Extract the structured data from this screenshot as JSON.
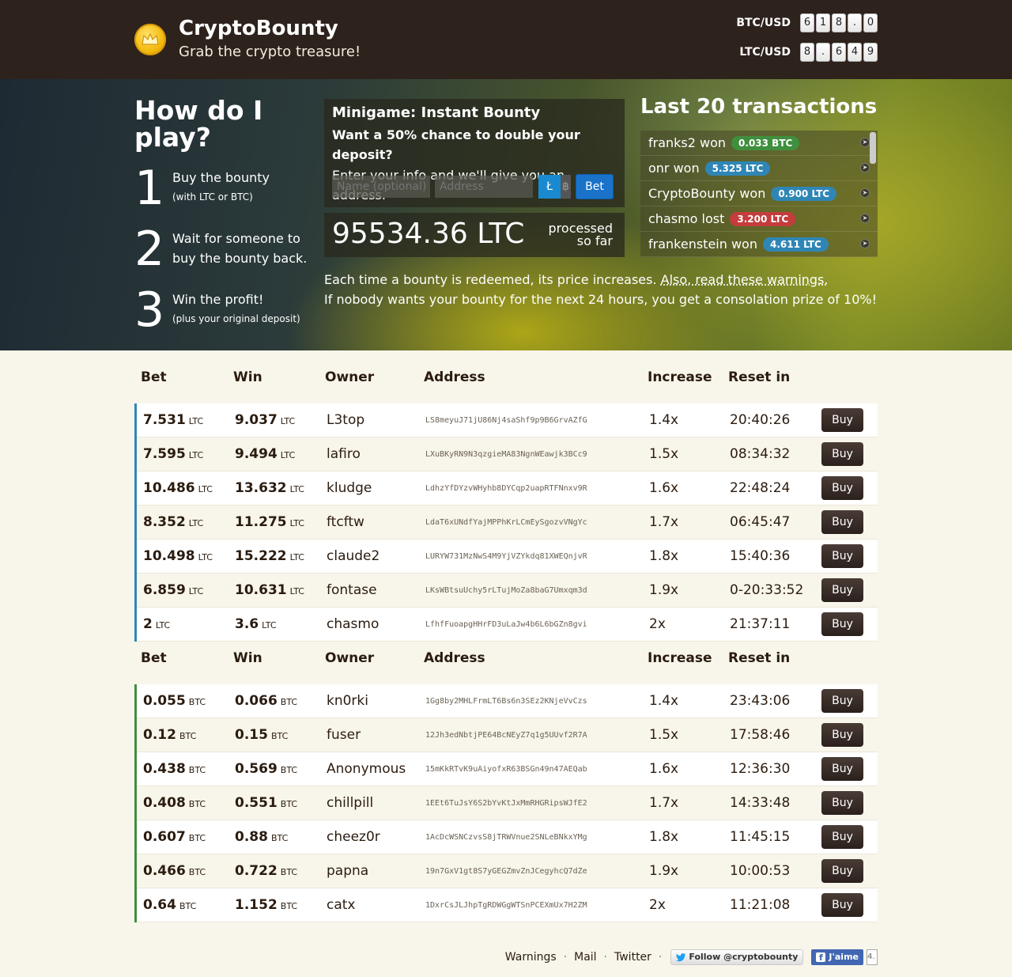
{
  "brand": {
    "title": "CryptoBounty",
    "subtitle": "Grab the crypto treasure!"
  },
  "tickers": [
    {
      "label": "BTC/USD",
      "digits": [
        "6",
        "1",
        "8",
        ".",
        "0"
      ]
    },
    {
      "label": "LTC/USD",
      "digits": [
        "8",
        ".",
        "6",
        "4",
        "9"
      ]
    }
  ],
  "howto": {
    "title": "How do I play?",
    "steps": [
      {
        "num": "1",
        "text": "Buy the bounty",
        "small": "(with LTC or BTC)"
      },
      {
        "num": "2",
        "text": "Wait for someone to buy the bounty back.",
        "small": ""
      },
      {
        "num": "3",
        "text": "Win the profit!",
        "small": "(plus your original deposit)"
      }
    ]
  },
  "minigame": {
    "title": "Minigame: Instant Bounty",
    "question": "Want a 50% chance to double your deposit?",
    "info": "Enter your info and we'll give you an address.",
    "name_placeholder": "Name (optional)",
    "address_placeholder": "Address",
    "ltc_symbol": "Ł",
    "btc_symbol": "฿",
    "bet_label": "Bet"
  },
  "processed": {
    "amount": "95534.36 LTC",
    "label": "processed so far"
  },
  "notes": {
    "line1": "Each time a bounty is redeemed, its price increases.",
    "line1_link": "Also, read these warnings.",
    "line2": "If nobody wants your bounty for the next 24 hours, you get a consolation prize of 10%!"
  },
  "transactions": {
    "title": "Last 20 transactions",
    "items": [
      {
        "text": "franks2 won",
        "badge": "0.033 BTC",
        "color": "#3f8f3f"
      },
      {
        "text": "onr won",
        "badge": "5.325 LTC",
        "color": "#2f86b5"
      },
      {
        "text": "CryptoBounty won",
        "badge": "0.900 LTC",
        "color": "#2f86b5"
      },
      {
        "text": "chasmo lost",
        "badge": "3.200 LTC",
        "color": "#c43c3c"
      },
      {
        "text": "frankenstein won",
        "badge": "4.611 LTC",
        "color": "#2f86b5"
      }
    ]
  },
  "table_headers": [
    "Bet",
    "Win",
    "Owner",
    "Address",
    "Increase",
    "Reset in"
  ],
  "buy_label": "Buy",
  "ltc_table": {
    "unit": "LTC",
    "accent": "#2f86b5",
    "rows": [
      {
        "bet": "7.531",
        "win": "9.037",
        "owner": "L3top",
        "address": "LS8meyuJ71jU86Nj4saShf9p9B6GrvAZfG",
        "increase": "1.4x",
        "reset": "20:40:26"
      },
      {
        "bet": "7.595",
        "win": "9.494",
        "owner": "lafiro",
        "address": "LXuBKyRN9N3qzgieMA83NgnWEawjk3BCc9",
        "increase": "1.5x",
        "reset": "08:34:32"
      },
      {
        "bet": "10.486",
        "win": "13.632",
        "owner": "kludge",
        "address": "LdhzYfDYzvWHyhb8DYCqp2uapRTFNnxv9R",
        "increase": "1.6x",
        "reset": "22:48:24"
      },
      {
        "bet": "8.352",
        "win": "11.275",
        "owner": "ftcftw",
        "address": "LdaT6xUNdfYajMPPhKrLCmEySgozvVNgYc",
        "increase": "1.7x",
        "reset": "06:45:47"
      },
      {
        "bet": "10.498",
        "win": "15.222",
        "owner": "claude2",
        "address": "LURYW731MzNwS4M9YjVZYkdq81XWEQnjvR",
        "increase": "1.8x",
        "reset": "15:40:36"
      },
      {
        "bet": "6.859",
        "win": "10.631",
        "owner": "fontase",
        "address": "LKsWBtsuUchy5rLTujMoZa8baG7Umxqm3d",
        "increase": "1.9x",
        "reset": "0-20:33:52"
      },
      {
        "bet": "2",
        "win": "3.6",
        "owner": "chasmo",
        "address": "LfhfFuoapgHHrFD3uLaJw4b6L6bGZn8gvi",
        "increase": "2x",
        "reset": "21:37:11"
      }
    ]
  },
  "btc_table": {
    "unit": "BTC",
    "accent": "#3f8f3f",
    "rows": [
      {
        "bet": "0.055",
        "win": "0.066",
        "owner": "kn0rki",
        "address": "1Gg8by2MHLFrmLT6Bs6n3SEz2KNjeVvCzs",
        "increase": "1.4x",
        "reset": "23:43:06"
      },
      {
        "bet": "0.12",
        "win": "0.15",
        "owner": "fuser",
        "address": "12Jh3edNbtjPE64BcNEyZ7q1g5UUvf2R7A",
        "increase": "1.5x",
        "reset": "17:58:46"
      },
      {
        "bet": "0.438",
        "win": "0.569",
        "owner": "Anonymous",
        "address": "15mKkRTvK9uAiyofxR63BSGn49n47AEQab",
        "increase": "1.6x",
        "reset": "12:36:30"
      },
      {
        "bet": "0.408",
        "win": "0.551",
        "owner": "chillpill",
        "address": "1EEt6TuJsY6S2bYvKtJxMmRHGRipsWJfE2",
        "increase": "1.7x",
        "reset": "14:33:48"
      },
      {
        "bet": "0.607",
        "win": "0.88",
        "owner": "cheez0r",
        "address": "1AcDcWSNCzvsS8jTRWVnue2SNLeBNkxYMg",
        "increase": "1.8x",
        "reset": "11:45:15"
      },
      {
        "bet": "0.466",
        "win": "0.722",
        "owner": "papna",
        "address": "19n7GxV1gt8S7yGEGZmvZnJCegyhcQ7dZe",
        "increase": "1.9x",
        "reset": "10:00:53"
      },
      {
        "bet": "0.64",
        "win": "1.152",
        "owner": "catx",
        "address": "1DxrCsJLJhpTgRDWGgWTSnPCEXmUx7H2ZM",
        "increase": "2x",
        "reset": "11:21:08"
      }
    ]
  },
  "footer": {
    "links": [
      "Warnings",
      "Mail",
      "Twitter"
    ],
    "follow_label": "Follow @cryptobounty",
    "like_label": "J'aime",
    "like_count": "4."
  }
}
